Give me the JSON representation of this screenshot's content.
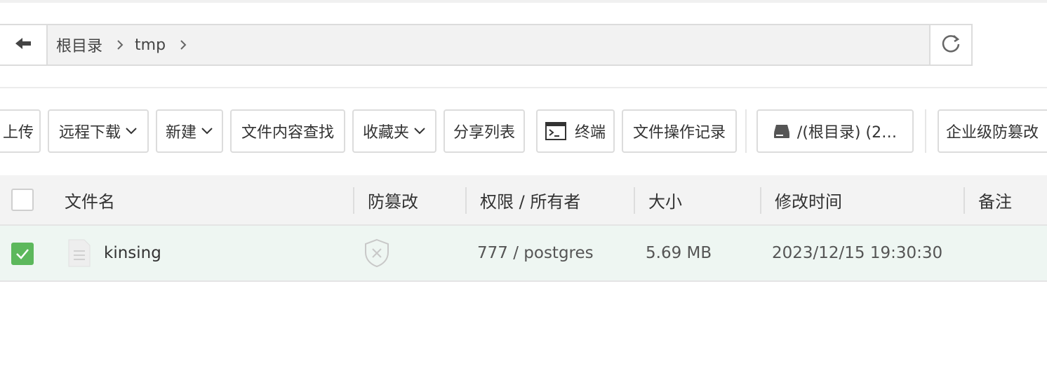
{
  "breadcrumb": {
    "items": [
      "根目录",
      "tmp"
    ]
  },
  "toolbar": {
    "upload": "上传",
    "remote_download": "远程下载",
    "new": "新建",
    "content_search": "文件内容查找",
    "favorites": "收藏夹",
    "share_list": "分享列表",
    "terminal": "终端",
    "operation_log": "文件操作记录",
    "disk": "/(根目录) (2…",
    "tamper_proof": "企业级防篡改"
  },
  "table": {
    "columns": [
      "文件名",
      "防篡改",
      "权限 / 所有者",
      "大小",
      "修改时间",
      "备注"
    ],
    "rows": [
      {
        "name": "kinsing",
        "permission": "777 / postgres",
        "size": "5.69 MB",
        "modified": "2023/12/15 19:30:30",
        "note": "",
        "checked": true
      }
    ]
  },
  "colors": {
    "check_green": "#5cb85c",
    "selected_row": "#eef6f2",
    "header_bg": "#f3f3f3"
  }
}
